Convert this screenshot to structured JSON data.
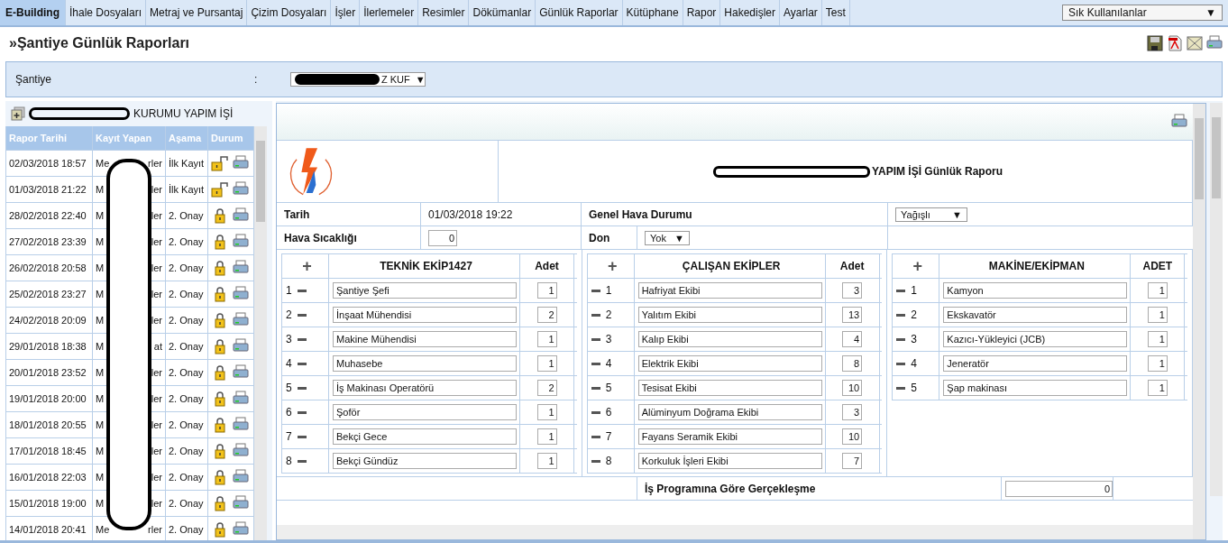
{
  "menu": [
    {
      "label": "E-Building",
      "selected": true
    },
    {
      "label": "İhale Dosyaları",
      "selected": false
    },
    {
      "label": "Metraj ve Pursantaj",
      "selected": false
    },
    {
      "label": "Çizim Dosyaları",
      "selected": false
    },
    {
      "label": "İşler",
      "selected": false
    },
    {
      "label": "İlerlemeler",
      "selected": false
    },
    {
      "label": "Resimler",
      "selected": false
    },
    {
      "label": "Dökümanlar",
      "selected": false
    },
    {
      "label": "Günlük Raporlar",
      "selected": false
    },
    {
      "label": "Kütüphane",
      "selected": false
    },
    {
      "label": "Rapor",
      "selected": false
    },
    {
      "label": "Hakedişler",
      "selected": false
    },
    {
      "label": "Ayarlar",
      "selected": false
    },
    {
      "label": "Test",
      "selected": false
    }
  ],
  "favorites": {
    "value": "Sık Kullanılanlar",
    "arrow": "▼"
  },
  "page_title": "»Şantiye Günlük Raporları",
  "site_filter": {
    "label": "Şantiye",
    "colon": ":",
    "value": "Z KUF",
    "arrow": "▼"
  },
  "project": {
    "name": "KURUMU YAPIM İŞİ"
  },
  "reports": {
    "columns": [
      "Rapor Tarihi",
      "Kayıt Yapan",
      "Aşama",
      "Durum"
    ],
    "rows": [
      {
        "date": "02/03/2018 18:57",
        "by_start": "Me",
        "by_end": "rler",
        "stage": "İlk Kayıt",
        "locked": false
      },
      {
        "date": "01/03/2018 21:22",
        "by_start": "M",
        "by_end": "ler",
        "stage": "İlk Kayıt",
        "locked": false
      },
      {
        "date": "28/02/2018 22:40",
        "by_start": "M",
        "by_end": "ler",
        "stage": "2. Onay",
        "locked": true
      },
      {
        "date": "27/02/2018 23:39",
        "by_start": "M",
        "by_end": "ler",
        "stage": "2. Onay",
        "locked": true
      },
      {
        "date": "26/02/2018 20:58",
        "by_start": "M",
        "by_end": "ler",
        "stage": "2. Onay",
        "locked": true
      },
      {
        "date": "25/02/2018 23:27",
        "by_start": "M",
        "by_end": "ler",
        "stage": "2. Onay",
        "locked": true
      },
      {
        "date": "24/02/2018 20:09",
        "by_start": "M",
        "by_end": "ler",
        "stage": "2. Onay",
        "locked": true
      },
      {
        "date": "29/01/2018 18:38",
        "by_start": "M",
        "by_end": "at",
        "stage": "2. Onay",
        "locked": true
      },
      {
        "date": "20/01/2018 23:52",
        "by_start": "M",
        "by_end": "ler",
        "stage": "2. Onay",
        "locked": true
      },
      {
        "date": "19/01/2018 20:00",
        "by_start": "M",
        "by_end": "ler",
        "stage": "2. Onay",
        "locked": true
      },
      {
        "date": "18/01/2018 20:55",
        "by_start": "M",
        "by_end": "ler",
        "stage": "2. Onay",
        "locked": true
      },
      {
        "date": "17/01/2018 18:45",
        "by_start": "M",
        "by_end": "ler",
        "stage": "2. Onay",
        "locked": true
      },
      {
        "date": "16/01/2018 22:03",
        "by_start": "M",
        "by_end": "ler",
        "stage": "2. Onay",
        "locked": true
      },
      {
        "date": "15/01/2018 19:00",
        "by_start": "M",
        "by_end": "ler",
        "stage": "2. Onay",
        "locked": true
      },
      {
        "date": "14/01/2018 20:41",
        "by_start": "Me",
        "by_end": "rler",
        "stage": "2. Onay",
        "locked": true
      }
    ]
  },
  "report": {
    "title": "YAPIM İŞİ Günlük Raporu",
    "date_label": "Tarih",
    "date": "01/03/2018 19:22",
    "weather_label": "Genel Hava Durumu",
    "weather": "Yağışlı",
    "weather_arrow": "▼",
    "temp_label": "Hava Sıcaklığı",
    "temp": "0",
    "frost_label": "Don",
    "frost": "Yok",
    "frost_arrow": "▼",
    "groups": [
      {
        "kind": "number-first",
        "add": "+",
        "title": "TEKNİK EKİP1427",
        "count_label": "Adet",
        "rows": [
          {
            "no": "1",
            "name": "Şantiye Şefi",
            "count": "1"
          },
          {
            "no": "2",
            "name": "İnşaat Mühendisi",
            "count": "2"
          },
          {
            "no": "3",
            "name": "Makine Mühendisi",
            "count": "1"
          },
          {
            "no": "4",
            "name": "Muhasebe",
            "count": "1"
          },
          {
            "no": "5",
            "name": "İş Makinası Operatörü",
            "count": "2"
          },
          {
            "no": "6",
            "name": "Şoför",
            "count": "1"
          },
          {
            "no": "7",
            "name": "Bekçi Gece",
            "count": "1"
          },
          {
            "no": "8",
            "name": "Bekçi Gündüz",
            "count": "1"
          }
        ]
      },
      {
        "kind": "minus-first",
        "add": "+",
        "title": "ÇALIŞAN EKİPLER",
        "count_label": "Adet",
        "rows": [
          {
            "no": "1",
            "name": "Hafriyat Ekibi",
            "count": "3"
          },
          {
            "no": "2",
            "name": "Yalıtım Ekibi",
            "count": "13"
          },
          {
            "no": "3",
            "name": "Kalıp Ekibi",
            "count": "4"
          },
          {
            "no": "4",
            "name": "Elektrik Ekibi",
            "count": "8"
          },
          {
            "no": "5",
            "name": "Tesisat Ekibi",
            "count": "10"
          },
          {
            "no": "6",
            "name": "Alüminyum Doğrama Ekibi",
            "count": "3"
          },
          {
            "no": "7",
            "name": "Fayans Seramik Ekibi",
            "count": "10"
          },
          {
            "no": "8",
            "name": "Korkuluk İşleri Ekibi",
            "count": "7"
          }
        ]
      },
      {
        "kind": "minus-first",
        "add": "+",
        "title": "MAKİNE/EKİPMAN",
        "count_label": "ADET",
        "rows": [
          {
            "no": "1",
            "name": "Kamyon",
            "count": "1"
          },
          {
            "no": "2",
            "name": "Ekskavatör",
            "count": "1"
          },
          {
            "no": "3",
            "name": "Kazıcı-Yükleyici (JCB)",
            "count": "1"
          },
          {
            "no": "4",
            "name": "Jeneratör",
            "count": "1"
          },
          {
            "no": "5",
            "name": "Şap makinası",
            "count": "1"
          }
        ]
      }
    ],
    "progress_label": "İş Programına Göre Gerçekleşme",
    "progress": "0"
  }
}
